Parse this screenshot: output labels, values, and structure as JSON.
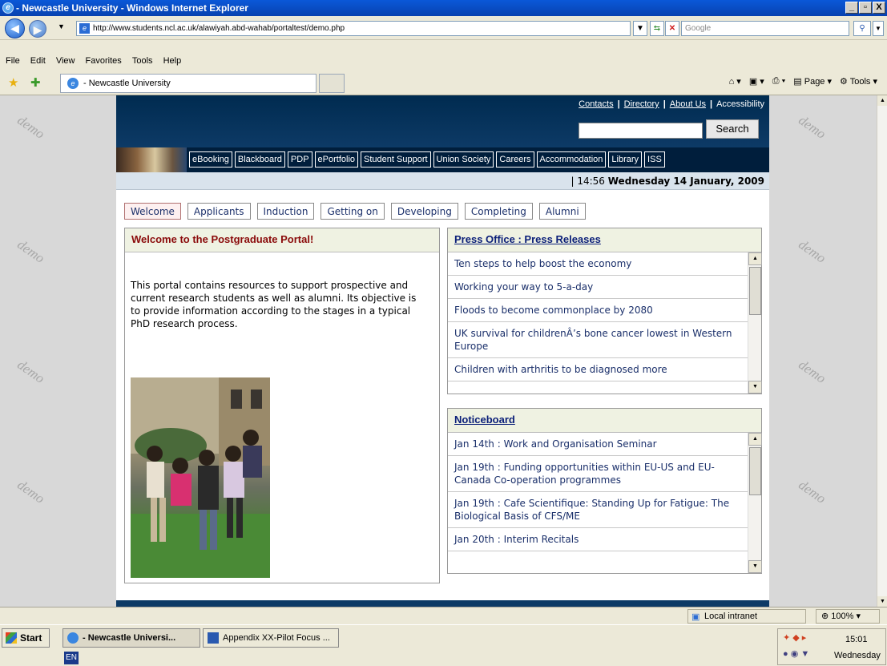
{
  "window": {
    "title": "- Newcastle University - Windows Internet Explorer",
    "controls": [
      "_",
      "▫",
      "X"
    ]
  },
  "address": {
    "url": "http://www.students.ncl.ac.uk/alawiyah.abd-wahab/portaltest/demo.php",
    "search_placeholder": "Google"
  },
  "menu": [
    "File",
    "Edit",
    "View",
    "Favorites",
    "Tools",
    "Help"
  ],
  "favbar": {
    "tab_title": "- Newcastle University",
    "page_label": "Page",
    "tools_label": "Tools"
  },
  "watermark": "demo",
  "site": {
    "toplinks": [
      "Contacts",
      "Directory",
      "About Us",
      "Accessibility"
    ],
    "search_button": "Search",
    "navlinks": [
      "eBooking",
      "Blackboard",
      "PDP",
      "ePortfolio",
      "Student Support",
      "Union Society",
      "Careers",
      "Accommodation",
      "Library",
      "ISS"
    ],
    "date_prefix": "| 14:56",
    "date_bold": "Wednesday 14 January, 2009",
    "tabs": [
      "Welcome",
      "Applicants",
      "Induction",
      "Getting on",
      "Developing",
      "Completing",
      "Alumni"
    ],
    "welcome": {
      "title": "Welcome to the Postgraduate Portal!",
      "text": "This portal contains resources to support prospective and current research students as well as alumni. Its objective is to provide information according to the stages in a typical PhD research process."
    },
    "press": {
      "title": "Press Office : Press Releases",
      "items": [
        "Ten steps to help boost the economy",
        "Working your way to 5-a-day",
        "Floods to become commonplace by 2080",
        "UK survival for childrenÂ’s bone cancer lowest in Western Europe",
        "Children with arthritis to be diagnosed more"
      ]
    },
    "notice": {
      "title": "Noticeboard",
      "items": [
        "Jan 14th : Work and Organisation Seminar",
        "Jan 19th : Funding opportunities within EU-US and EU-Canada Co-operation programmes",
        "Jan 19th : Cafe Scientifique: Standing Up for Fatigue: The Biological Basis of CFS/ME",
        "Jan 20th : Interim Recitals"
      ]
    }
  },
  "status": {
    "zone": "Local intranet",
    "zoom": "100%"
  },
  "taskbar": {
    "start": "Start",
    "tasks": [
      "- Newcastle Universi...",
      "Appendix XX-Pilot Focus ..."
    ],
    "time": "15:01",
    "day": "Wednesday",
    "lang": "EN"
  }
}
